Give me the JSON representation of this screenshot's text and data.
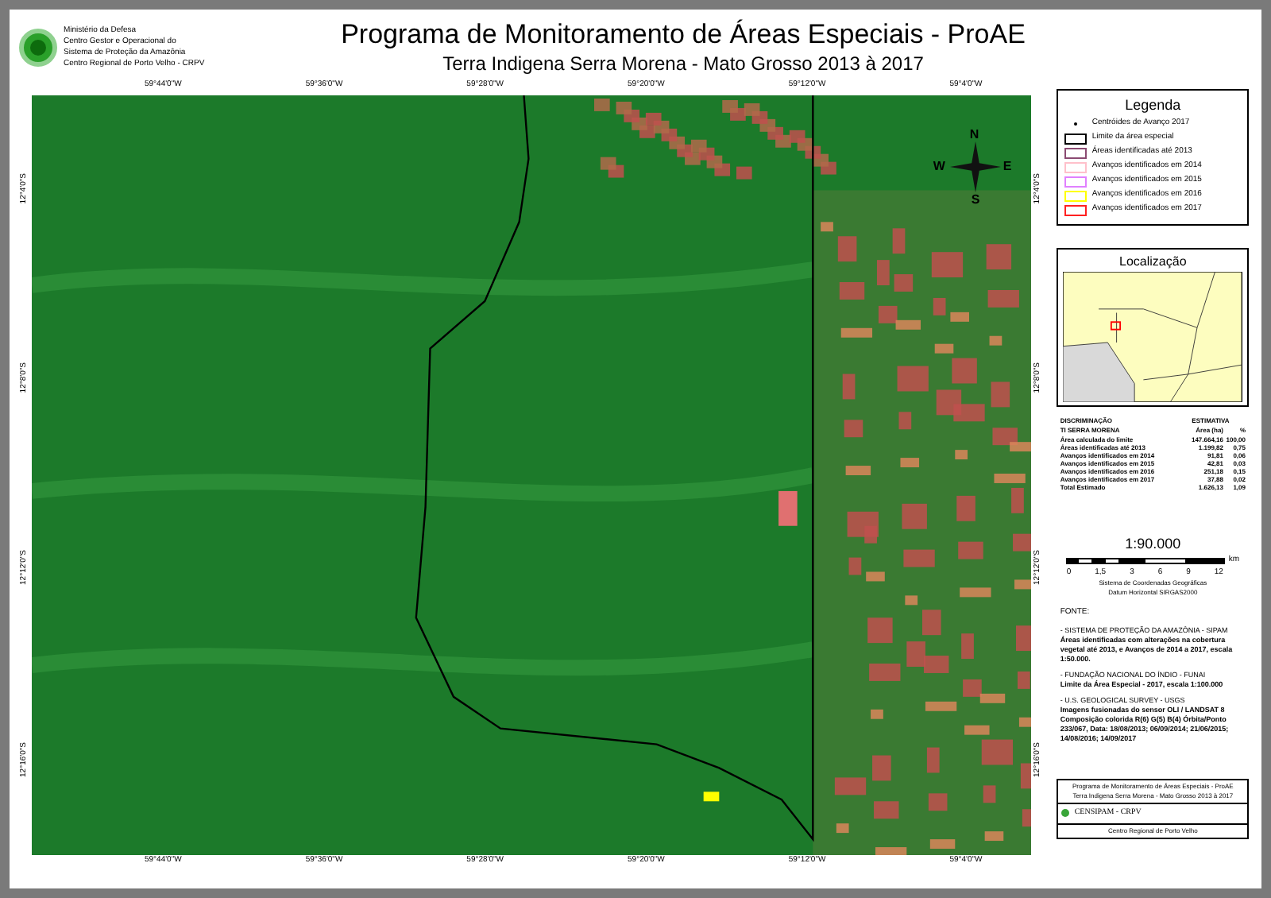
{
  "logo_text": [
    "Ministério da Defesa",
    "Centro Gestor e Operacional do",
    "Sistema de Proteção da Amazônia",
    "Centro Regional de Porto Velho - CRPV"
  ],
  "title": "Programa de Monitoramento de Áreas Especiais - ProAE",
  "subtitle": "Terra Indigena Serra Morena - Mato Grosso 2013 à 2017",
  "map": {
    "top_ticks": [
      "59°44'0\"W",
      "59°36'0\"W",
      "59°28'0\"W",
      "59°20'0\"W",
      "59°12'0\"W",
      "59°4'0\"W"
    ],
    "bottom_ticks": [
      "59°44'0\"W",
      "59°36'0\"W",
      "59°28'0\"W",
      "59°20'0\"W",
      "59°12'0\"W",
      "59°4'0\"W"
    ],
    "left_ticks": [
      "12°4'0\"S",
      "12°8'0\"S",
      "12°12'0\"S",
      "12°16'0\"S"
    ],
    "right_ticks": [
      "12°4'0\"S",
      "12°8'0\"S",
      "12°12'0\"S",
      "12°16'0\"S"
    ]
  },
  "compass": {
    "north": "N",
    "south": "S",
    "east": "E",
    "west": "W"
  },
  "legend": {
    "title": "Legenda",
    "items": [
      {
        "kind": "dot",
        "label": "Centróides de Avanço 2017",
        "color": "#000000"
      },
      {
        "kind": "box",
        "label": "Limite da área especial",
        "color": "#000000"
      },
      {
        "kind": "box",
        "label": "Áreas identificadas  até 2013",
        "color": "#8b4a72"
      },
      {
        "kind": "box",
        "label": "Avanços identificados em 2014",
        "color": "#ffc0cb"
      },
      {
        "kind": "box",
        "label": "Avanços identificados em 2015",
        "color": "#e080ff"
      },
      {
        "kind": "box",
        "label": "Avanços identificados em 2016",
        "color": "#ffff00"
      },
      {
        "kind": "box",
        "label": "Avanços identificados em 2017",
        "color": "#ff2020"
      }
    ]
  },
  "location": {
    "title": "Localização"
  },
  "stats": {
    "head": [
      "DISCRIMINAÇÃO",
      "ESTIMATIVA"
    ],
    "subhead": [
      "TI SERRA MORENA",
      "Área (ha)",
      "%"
    ],
    "rows": [
      [
        "Área calculada do limite",
        "147.664,16",
        "100,00"
      ],
      [
        "Áreas identificadas  até 2013",
        "1.199,82",
        "0,75"
      ],
      [
        "Avanços identificados em 2014",
        "91,81",
        "0,06"
      ],
      [
        "Avanços identificados em 2015",
        "42,81",
        "0,03"
      ],
      [
        "Avanços identificados em 2016",
        "251,18",
        "0,15"
      ],
      [
        "Avanços identificados em 2017",
        "37,88",
        "0,02"
      ],
      [
        "Total Estimado",
        "1.626,13",
        "1,09"
      ]
    ]
  },
  "scale": {
    "ratio": "1:90.000",
    "ticks": [
      "0",
      "1,5",
      "3",
      "6",
      "9",
      "12"
    ],
    "unit": "km",
    "notes": [
      "Sistema de Coordenadas Geográficas",
      "Datum Horizontal SIRGAS2000"
    ]
  },
  "sources": {
    "title": "FONTE:",
    "items": [
      {
        "head": "- SISTEMA DE PROTEÇÃO DA AMAZÔNIA - SIPAM",
        "body": "Áreas identificadas com alterações na cobertura vegetal até 2013, e Avanços de 2014 a 2017, escala 1:50.000."
      },
      {
        "head": "- FUNDAÇÃO NACIONAL DO ÍNDIO - FUNAI",
        "body": "Limite da  Área Especial - 2017, escala 1:100.000"
      },
      {
        "head": "- U.S. GEOLOGICAL SURVEY - USGS",
        "body": "Imagens fusionadas do sensor OLI / LANDSAT 8 Composição colorida R(6) G(5) B(4) Órbita/Ponto 233/067, Data: 18/08/2013; 06/09/2014; 21/06/2015; 14/08/2016; 14/09/2017"
      }
    ]
  },
  "footer": {
    "title": "Programa de Monitoramento de Áreas Especiais - ProAE",
    "subtitle": "Terra Indigena Serra Morena - Mato Grosso 2013 à 2017",
    "org": "CENSIPAM - CRPV",
    "address": "Centro Regional de Porto Velho"
  }
}
